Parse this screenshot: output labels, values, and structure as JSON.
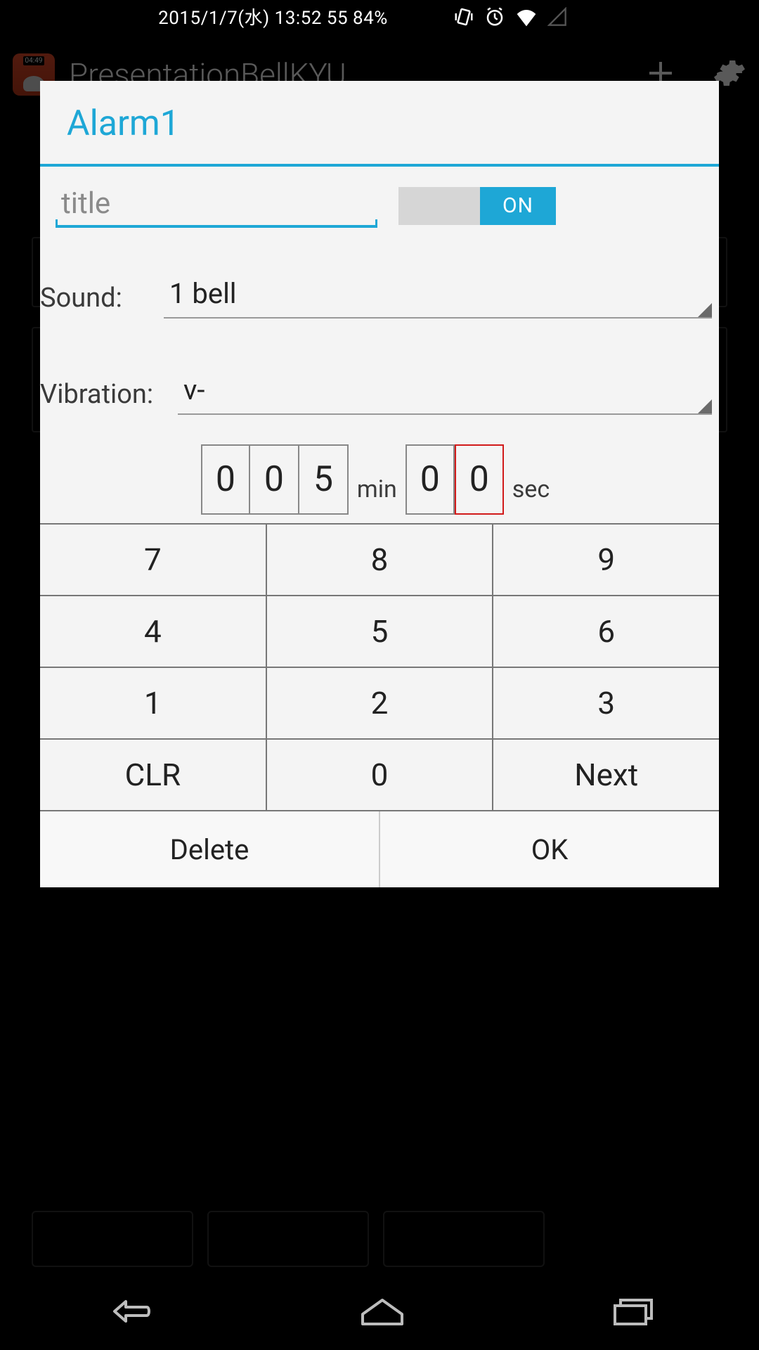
{
  "statusbar": {
    "text": "2015/1/7(水) 13:52 55 84%"
  },
  "app": {
    "title": "PresentationBellKYU"
  },
  "dialog": {
    "title": "Alarm1",
    "title_placeholder": "title",
    "title_value": "",
    "toggle_label": "ON",
    "sound_label": "Sound:",
    "sound_value": "1 bell",
    "vibration_label": "Vibration:",
    "vibration_value": "v-",
    "min_label": "min",
    "sec_label": "sec",
    "digits_min": [
      "0",
      "0",
      "5"
    ],
    "digits_sec": [
      "0",
      "0"
    ],
    "keypad": {
      "r1": [
        "7",
        "8",
        "9"
      ],
      "r2": [
        "4",
        "5",
        "6"
      ],
      "r3": [
        "1",
        "2",
        "3"
      ],
      "r4": [
        "CLR",
        "0",
        "Next"
      ]
    },
    "delete_label": "Delete",
    "ok_label": "OK"
  }
}
